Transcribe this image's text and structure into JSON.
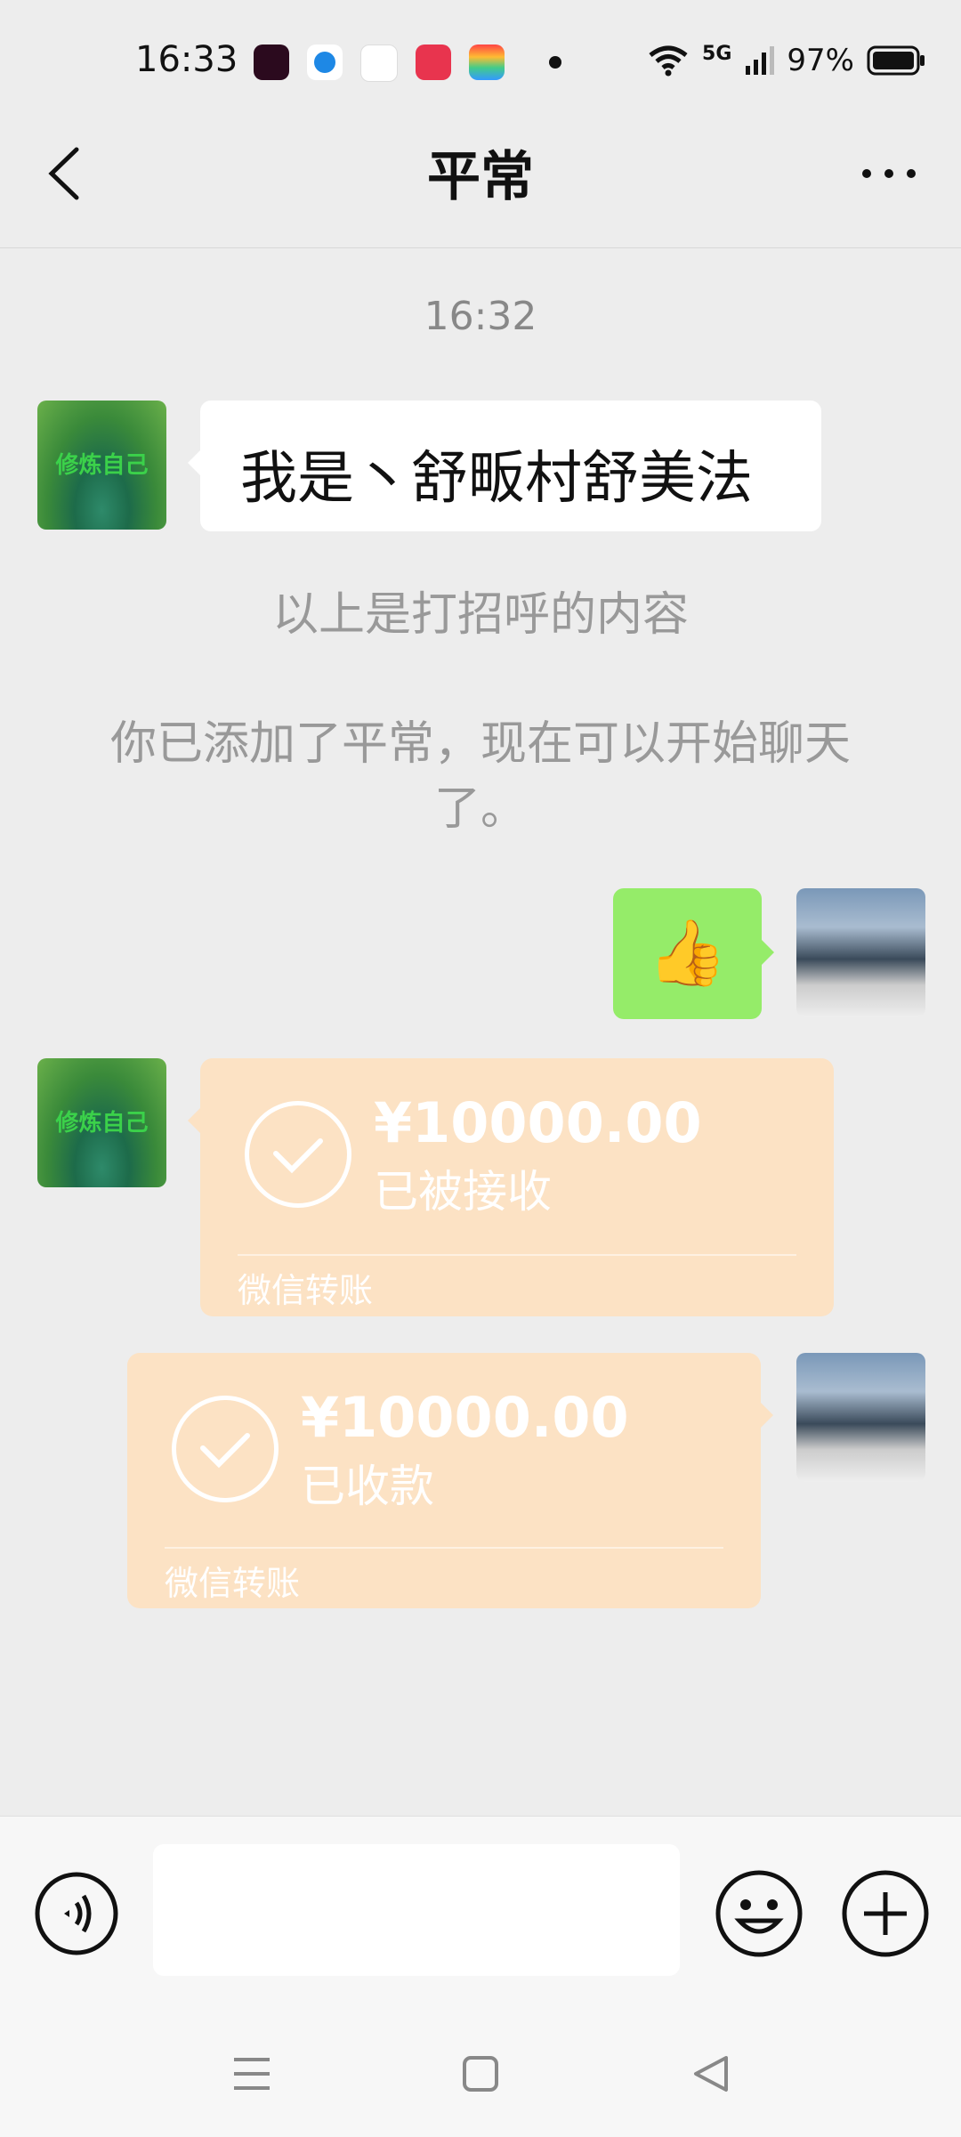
{
  "status_bar": {
    "time": "16:33",
    "network": "5G",
    "battery": "97%",
    "app_icons": [
      "douyin-icon",
      "blue-circle-app-icon",
      "xiangxin-app-icon",
      "red-play-app-icon",
      "wallet-app-icon"
    ]
  },
  "header": {
    "title": "平常",
    "back_icon": "chevron-left-icon",
    "more_icon": "more-dots-icon"
  },
  "chat": {
    "timestamp": "16:32",
    "greeting_message": "我是丶舒畈村舒美法",
    "avatar_left_text": "修炼自己",
    "system_notice_1": "以上是打招呼的内容",
    "system_notice_2": "你已添加了平常，现在可以开始聊天了。",
    "sent_emoji": "👍",
    "transfer_received": {
      "amount": "¥10000.00",
      "status": "已被接收",
      "footer": "微信转账"
    },
    "transfer_sent": {
      "amount": "¥10000.00",
      "status": "已收款",
      "footer": "微信转账"
    }
  },
  "input_bar": {
    "value": "",
    "placeholder": ""
  },
  "colors": {
    "background": "#ededed",
    "sent_bubble": "#95ec69",
    "transfer_bubble": "#fce2c4",
    "system_text": "#999999"
  }
}
